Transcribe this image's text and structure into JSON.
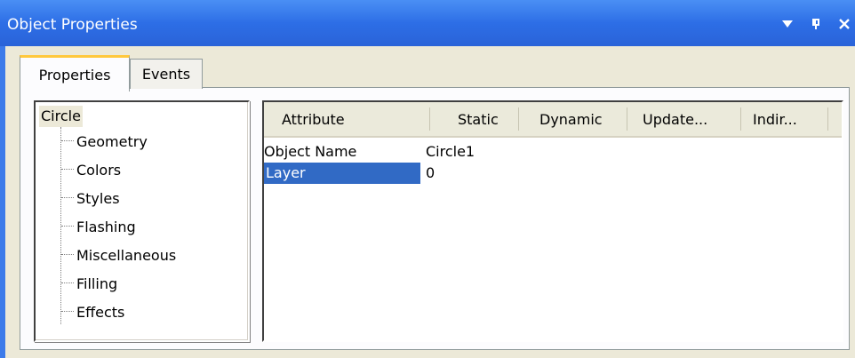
{
  "window": {
    "title": "Object Properties",
    "controls": {
      "menu": "▼",
      "pin": "ᵖ",
      "close": "✕"
    }
  },
  "tabs": [
    {
      "label": "Properties",
      "active": true
    },
    {
      "label": "Events",
      "active": false
    }
  ],
  "tree": {
    "root": "Circle",
    "children": [
      "Geometry",
      "Colors",
      "Styles",
      "Flashing",
      "Miscellaneous",
      "Filling",
      "Effects"
    ]
  },
  "grid": {
    "columns": [
      "Attribute",
      "Static",
      "Dynamic",
      "Update...",
      "Indir..."
    ],
    "rows": [
      {
        "attribute": "Object Name",
        "static": "Circle1",
        "selected": false
      },
      {
        "attribute": "Layer",
        "static": "0",
        "selected": true
      }
    ]
  },
  "colors": {
    "titlebar": "#2D6EE6",
    "selection": "#316AC5",
    "tab_highlight": "#FFC83C"
  }
}
